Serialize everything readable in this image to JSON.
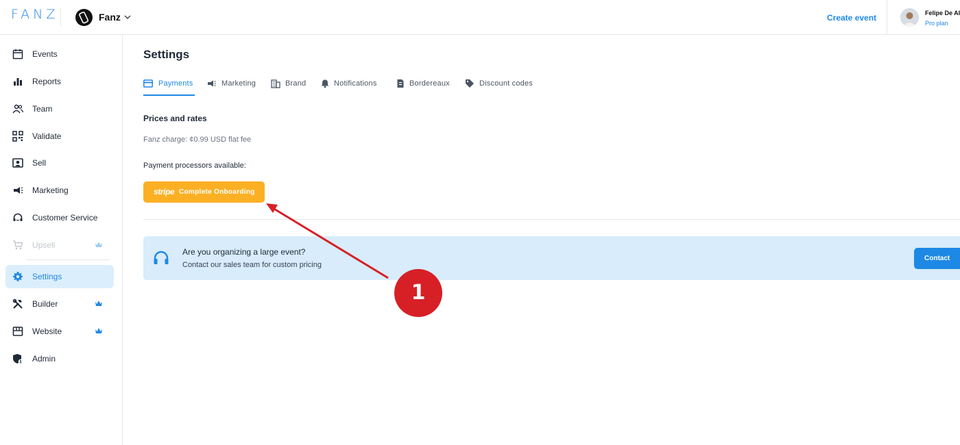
{
  "header": {
    "logo": "FANZ",
    "org_name": "Fanz",
    "create_event": "Create event",
    "user_name": "Felipe De Al",
    "user_plan": "Pro plan"
  },
  "sidebar": {
    "items": [
      {
        "label": "Events",
        "icon": "calendar-icon"
      },
      {
        "label": "Reports",
        "icon": "bar-chart-icon"
      },
      {
        "label": "Team",
        "icon": "users-icon"
      },
      {
        "label": "Validate",
        "icon": "qr-code-icon"
      },
      {
        "label": "Sell",
        "icon": "user-card-icon"
      },
      {
        "label": "Marketing",
        "icon": "megaphone-icon"
      },
      {
        "label": "Customer Service",
        "icon": "headset-icon"
      },
      {
        "label": "Upsell",
        "icon": "cart-icon",
        "crown": true,
        "disabled": true
      },
      {
        "label": "Settings",
        "icon": "gear-icon",
        "active": true
      },
      {
        "label": "Builder",
        "icon": "tools-icon",
        "crown": true
      },
      {
        "label": "Website",
        "icon": "storefront-icon",
        "crown": true
      },
      {
        "label": "Admin",
        "icon": "shield-user-icon"
      }
    ],
    "active_color": "#1e88e5",
    "crown_color": "#1e88e5"
  },
  "main": {
    "title": "Settings",
    "tabs": [
      {
        "label": "Payments",
        "icon": "credit-card-icon",
        "active": true
      },
      {
        "label": "Marketing",
        "icon": "megaphone-icon"
      },
      {
        "label": "Brand",
        "icon": "building-icon"
      },
      {
        "label": "Notifications",
        "icon": "bell-icon"
      },
      {
        "label": "Bordereaux",
        "icon": "document-icon"
      },
      {
        "label": "Discount codes",
        "icon": "tag-icon"
      }
    ],
    "section_title": "Prices and rates",
    "fee_text": "Fanz charge: ¢0.99 USD flat fee",
    "processors_label": "Payment processors available:",
    "stripe_logo": "stripe",
    "stripe_button": "Complete Onboarding",
    "stripe_color": "#fbb024",
    "banner": {
      "title": "Are you organizing a large event?",
      "subtitle": "Contact our sales team for custom pricing",
      "button": "Contact",
      "background": "#d8ecfb"
    }
  },
  "annotation": {
    "step": "1",
    "color": "#d71f26"
  }
}
